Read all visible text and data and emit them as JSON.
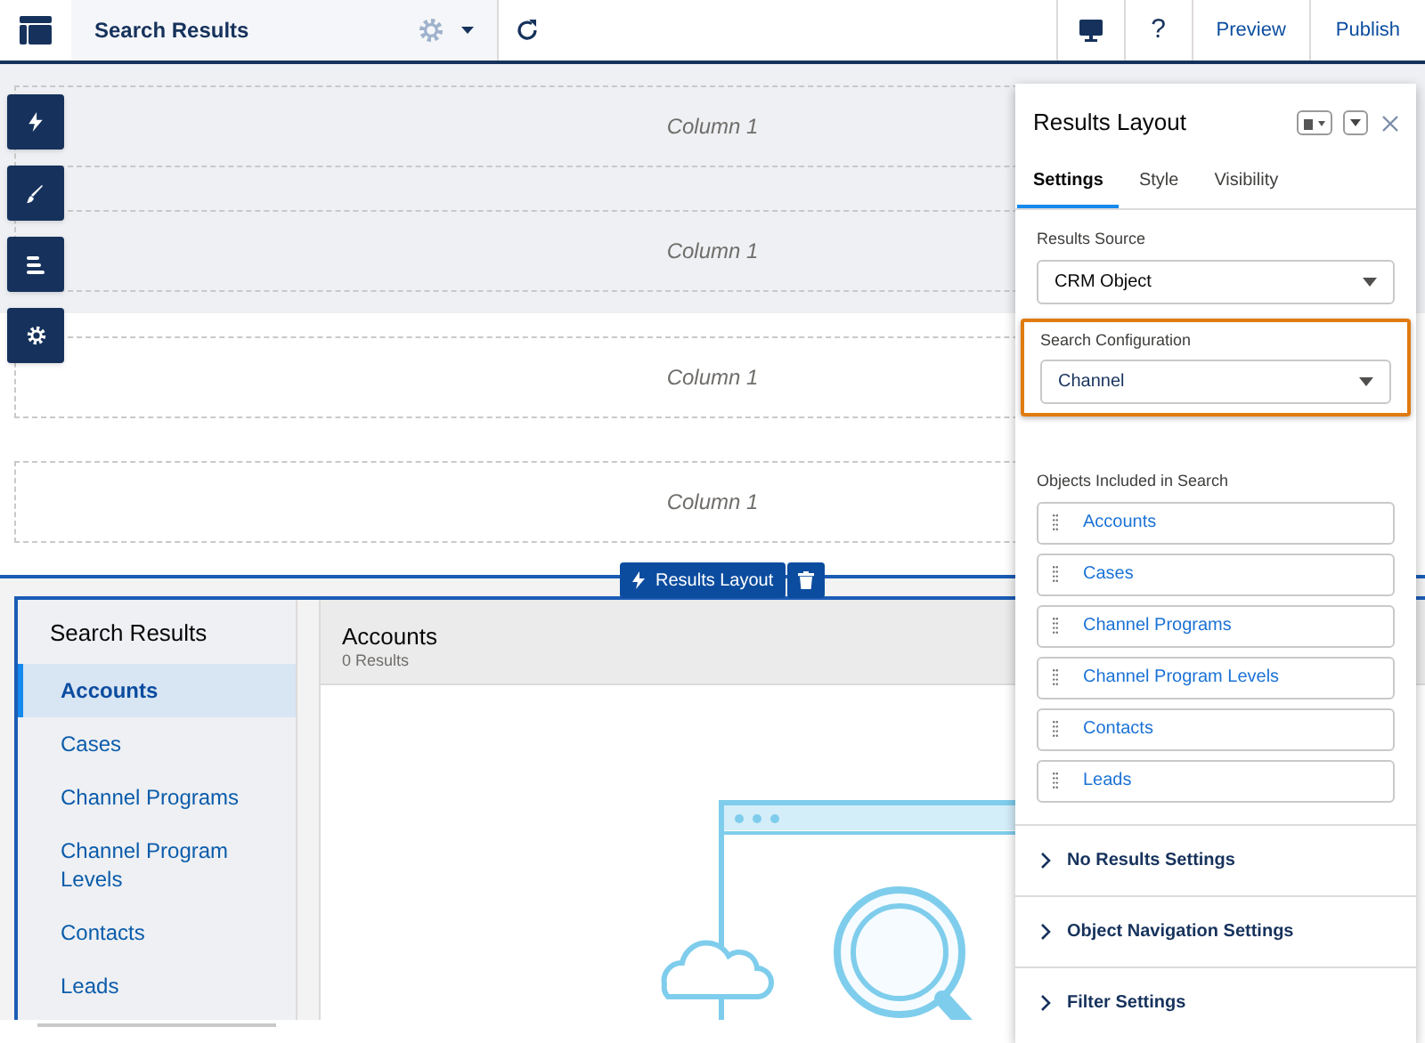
{
  "toolbar": {
    "title": "Search Results",
    "buttons": [
      "Preview",
      "Publish"
    ],
    "help": "?"
  },
  "canvas": {
    "sections": [
      {
        "label": "Column 1",
        "shaded": true
      },
      {
        "label": "Column 1",
        "shaded": true
      },
      {
        "label": "Column 1",
        "shaded": false
      },
      {
        "label": "Column 1",
        "shaded": false
      }
    ]
  },
  "component_badge": {
    "label": "Results Layout"
  },
  "results_nav": {
    "title": "Search Results",
    "items": [
      {
        "label": "Accounts",
        "selected": true
      },
      {
        "label": "Cases",
        "selected": false
      },
      {
        "label": "Channel Programs",
        "selected": false
      },
      {
        "label": "Channel Program Levels",
        "selected": false
      },
      {
        "label": "Contacts",
        "selected": false
      },
      {
        "label": "Leads",
        "selected": false
      }
    ]
  },
  "results_header": {
    "title": "Accounts",
    "count": "0 Results"
  },
  "panel": {
    "title": "Results Layout",
    "tabs": [
      {
        "label": "Settings",
        "selected": true
      },
      {
        "label": "Style",
        "selected": false
      },
      {
        "label": "Visibility",
        "selected": false
      }
    ],
    "results_source": {
      "label": "Results Source",
      "value": "CRM Object"
    },
    "search_configuration": {
      "label": "Search Configuration",
      "value": "Channel",
      "highlighted": true
    },
    "objects": {
      "label": "Objects Included in Search",
      "items": [
        "Accounts",
        "Cases",
        "Channel Programs",
        "Channel Program Levels",
        "Contacts",
        "Leads"
      ]
    },
    "sections": [
      {
        "label": "No Results Settings",
        "expanded": false
      },
      {
        "label": "Object Navigation Settings",
        "expanded": false
      },
      {
        "label": "Filter Settings",
        "expanded": false
      }
    ]
  }
}
